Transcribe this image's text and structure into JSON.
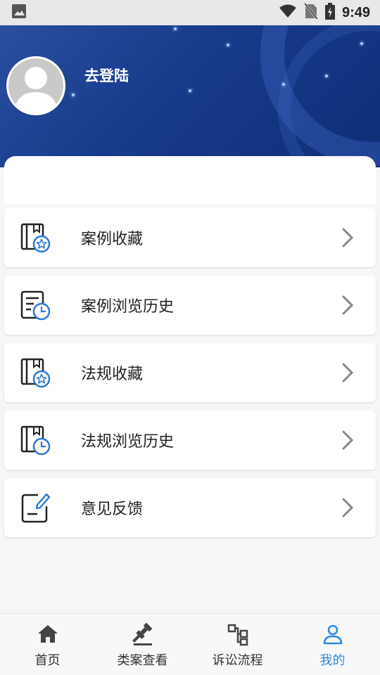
{
  "status_bar": {
    "time": "9:49",
    "icons": [
      "image-icon",
      "wifi-icon",
      "no-sim-icon",
      "battery-charging-icon"
    ]
  },
  "header": {
    "login_label": "去登陆",
    "avatar_icon": "default-avatar-icon"
  },
  "menu": {
    "items": [
      {
        "label": "案例收藏",
        "icon": "case-favorite-icon"
      },
      {
        "label": "案例浏览历史",
        "icon": "case-history-icon"
      },
      {
        "label": "法规收藏",
        "icon": "law-favorite-icon"
      },
      {
        "label": "法规浏览历史",
        "icon": "law-history-icon"
      },
      {
        "label": "意见反馈",
        "icon": "feedback-icon"
      }
    ]
  },
  "bottom_nav": {
    "items": [
      {
        "label": "首页",
        "icon": "home-icon"
      },
      {
        "label": "类案查看",
        "icon": "gavel-icon"
      },
      {
        "label": "诉讼流程",
        "icon": "flowchart-icon"
      },
      {
        "label": "我的",
        "icon": "user-icon",
        "active": true
      }
    ]
  },
  "colors": {
    "accent": "#2a8be6",
    "header_bg": "#173a8a",
    "icon_dark": "#222222"
  }
}
